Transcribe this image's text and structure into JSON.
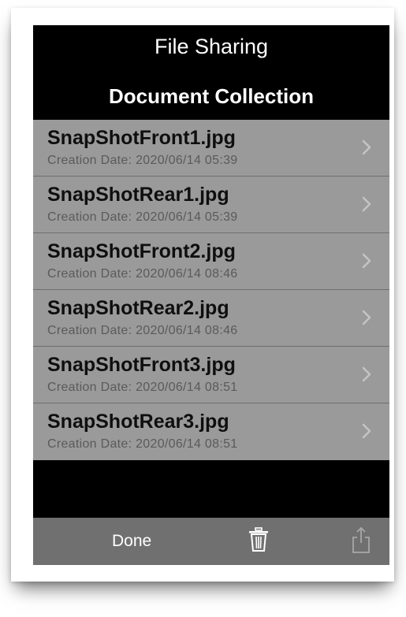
{
  "nav": {
    "title": "File Sharing"
  },
  "section": {
    "title": "Document Collection"
  },
  "files": [
    {
      "name": "SnapShotFront1.jpg",
      "date": "Creation Date: 2020/06/14 05:39"
    },
    {
      "name": "SnapShotRear1.jpg",
      "date": "Creation Date: 2020/06/14 05:39"
    },
    {
      "name": "SnapShotFront2.jpg",
      "date": "Creation Date: 2020/06/14 08:46"
    },
    {
      "name": "SnapShotRear2.jpg",
      "date": "Creation Date: 2020/06/14 08:46"
    },
    {
      "name": "SnapShotFront3.jpg",
      "date": "Creation Date: 2020/06/14 08:51"
    },
    {
      "name": "SnapShotRear3.jpg",
      "date": "Creation Date: 2020/06/14 08:51"
    }
  ],
  "toolbar": {
    "done_label": "Done",
    "trash_icon": "trash-icon",
    "share_icon": "share-icon"
  },
  "colors": {
    "screen_background": "#000000",
    "list_background": "#9a9a9a",
    "toolbar_background": "#707070",
    "title_text": "#ffffff",
    "row_name_text": "#0f0f0f",
    "row_date_text": "#5a5a5a"
  }
}
